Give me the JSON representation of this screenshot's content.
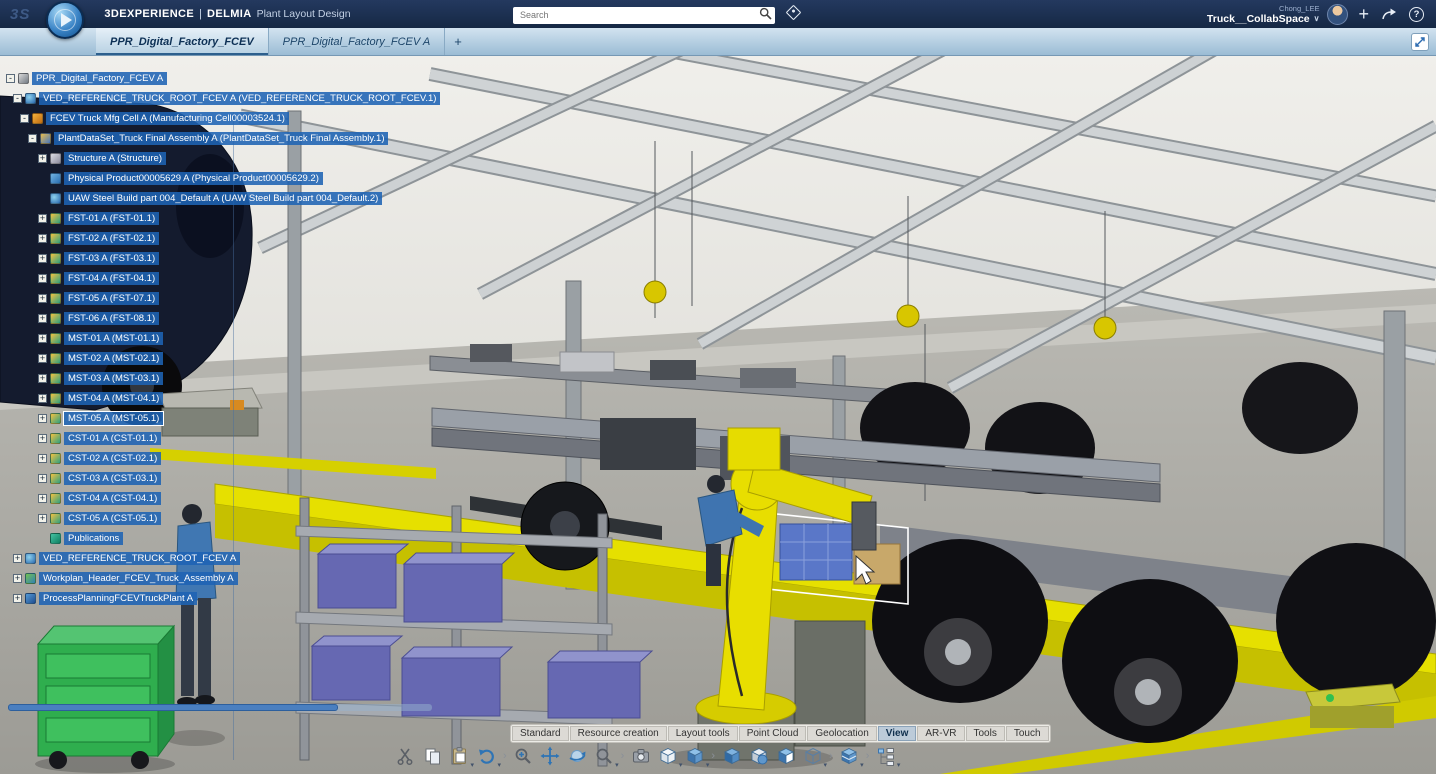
{
  "header": {
    "ds_mark": "3S",
    "brand": "3DEXPERIENCE",
    "brand_sep": "|",
    "app_brand": "DELMIA",
    "app_name": "Plant Layout Design",
    "search_placeholder": "Search",
    "user_name": "Chong_LEE",
    "collab_space": "Truck__CollabSpace",
    "collab_caret": "∨",
    "add_glyph": "+",
    "help_glyph": "?"
  },
  "tab_bar": {
    "new_tab_glyph": "+",
    "tabs": [
      {
        "label": "PPR_Digital_Factory_FCEV",
        "active": true
      },
      {
        "label": "PPR_Digital_Factory_FCEV A",
        "active": false
      }
    ]
  },
  "tree": {
    "expander_plus": "+",
    "expander_minus": "-",
    "items": [
      {
        "level": 0,
        "expander": "minus",
        "icon": "root",
        "label": "PPR_Digital_Factory_FCEV A",
        "selected": true
      },
      {
        "level": 1,
        "expander": "minus",
        "icon": "ved-root",
        "label": "VED_REFERENCE_TRUCK_ROOT_FCEV A (VED_REFERENCE_TRUCK_ROOT_FCEV.1)",
        "selected": true
      },
      {
        "level": 2,
        "expander": "minus",
        "icon": "mfg-cell",
        "label": "FCEV Truck Mfg Cell A (Manufacturing Cell00003524.1)",
        "selected": true
      },
      {
        "level": 3,
        "expander": "minus",
        "icon": "dataset",
        "label": "PlantDataSet_Truck Final Assembly A (PlantDataSet_Truck Final Assembly.1)",
        "selected": true
      },
      {
        "level": 4,
        "expander": "plus",
        "icon": "structure",
        "label": "Structure A (Structure)",
        "selected": true
      },
      {
        "level": 4,
        "expander": null,
        "icon": "product",
        "label": "Physical Product00005629 A (Physical Product00005629.2)",
        "selected": true
      },
      {
        "level": 4,
        "expander": null,
        "icon": "ved-root",
        "label": "UAW Steel Build part 004_Default A (UAW Steel Build part 004_Default.2)",
        "selected": true
      },
      {
        "level": 4,
        "expander": "plus",
        "icon": "part",
        "label": "FST-01 A (FST-01.1)",
        "selected": true
      },
      {
        "level": 4,
        "expander": "plus",
        "icon": "part",
        "label": "FST-02 A (FST-02.1)",
        "selected": true
      },
      {
        "level": 4,
        "expander": "plus",
        "icon": "part",
        "label": "FST-03 A (FST-03.1)",
        "selected": true
      },
      {
        "level": 4,
        "expander": "plus",
        "icon": "part",
        "label": "FST-04 A (FST-04.1)",
        "selected": true
      },
      {
        "level": 4,
        "expander": "plus",
        "icon": "part",
        "label": "FST-05 A (FST-07.1)",
        "selected": true
      },
      {
        "level": 4,
        "expander": "plus",
        "icon": "part",
        "label": "FST-06 A (FST-08.1)",
        "selected": true
      },
      {
        "level": 4,
        "expander": "plus",
        "icon": "part",
        "label": "MST-01 A (MST-01.1)",
        "selected": true
      },
      {
        "level": 4,
        "expander": "plus",
        "icon": "part",
        "label": "MST-02 A (MST-02.1)",
        "selected": true
      },
      {
        "level": 4,
        "expander": "plus",
        "icon": "part",
        "label": "MST-03 A (MST-03.1)",
        "selected": true
      },
      {
        "level": 4,
        "expander": "plus",
        "icon": "part",
        "label": "MST-04 A (MST-04.1)",
        "selected": true
      },
      {
        "level": 4,
        "expander": "plus",
        "icon": "part",
        "label": "MST-05 A (MST-05.1)",
        "selected": true,
        "focused": true
      },
      {
        "level": 4,
        "expander": "plus",
        "icon": "part",
        "label": "CST-01 A (CST-01.1)",
        "selected": true
      },
      {
        "level": 4,
        "expander": "plus",
        "icon": "part",
        "label": "CST-02 A (CST-02.1)",
        "selected": true
      },
      {
        "level": 4,
        "expander": "plus",
        "icon": "part",
        "label": "CST-03 A (CST-03.1)",
        "selected": true
      },
      {
        "level": 4,
        "expander": "plus",
        "icon": "part",
        "label": "CST-04 A (CST-04.1)",
        "selected": true
      },
      {
        "level": 4,
        "expander": "plus",
        "icon": "part",
        "label": "CST-05 A (CST-05.1)",
        "selected": true
      },
      {
        "level": 4,
        "expander": null,
        "icon": "publications",
        "label": "Publications",
        "selected": true
      },
      {
        "level": 1,
        "expander": "plus",
        "icon": "ved-root",
        "label": "VED_REFERENCE_TRUCK_ROOT_FCEV A",
        "selected": true
      },
      {
        "level": 1,
        "expander": "plus",
        "icon": "workplan",
        "label": "Workplan_Header_FCEV_Truck_Assembly A",
        "selected": true
      },
      {
        "level": 1,
        "expander": "plus",
        "icon": "process",
        "label": "ProcessPlanningFCEVTruckPlant A",
        "selected": true
      }
    ]
  },
  "ribbon": {
    "active": "View",
    "tabs": [
      "Standard",
      "Resource creation",
      "Layout tools",
      "Point Cloud",
      "Geolocation",
      "View",
      "AR-VR",
      "Tools",
      "Touch"
    ]
  },
  "toolbar": {
    "caret_glyph": "▾",
    "sep_glyph": "›",
    "items": [
      {
        "name": "cut",
        "icon": "cut"
      },
      {
        "name": "copy",
        "icon": "copy"
      },
      {
        "name": "paste",
        "icon": "paste",
        "caret": true
      },
      {
        "name": "undo",
        "icon": "undo",
        "caret": true
      },
      {
        "type": "sep"
      },
      {
        "name": "zoom-area",
        "icon": "zoom-in"
      },
      {
        "name": "pan",
        "icon": "pan"
      },
      {
        "name": "rotate",
        "icon": "rotate"
      },
      {
        "name": "zoom",
        "icon": "zoom",
        "caret": true
      },
      {
        "type": "sep"
      },
      {
        "name": "capture",
        "icon": "camera"
      },
      {
        "name": "iso-view",
        "icon": "cube-outline",
        "caret": true
      },
      {
        "name": "named-views",
        "icon": "cube-blue",
        "caret": true
      },
      {
        "type": "sep"
      },
      {
        "name": "shading",
        "icon": "cube-solid"
      },
      {
        "name": "shading-material",
        "icon": "cube-globe"
      },
      {
        "name": "shading-image",
        "icon": "cube-image"
      },
      {
        "name": "wireframe",
        "icon": "cube-wire",
        "caret": true
      },
      {
        "type": "sep"
      },
      {
        "name": "section",
        "icon": "cube-layers",
        "caret": true
      },
      {
        "type": "sep"
      },
      {
        "name": "work-tree",
        "icon": "tree",
        "caret": true
      }
    ]
  }
}
